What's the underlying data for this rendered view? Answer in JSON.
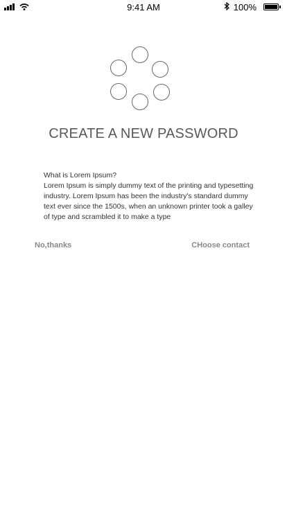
{
  "status_bar": {
    "time": "9:41 AM",
    "battery_percent": "100%",
    "icons": [
      "signal-icon",
      "wifi-icon",
      "bluetooth-icon",
      "battery-icon"
    ]
  },
  "screen": {
    "title": "CREATE A NEW PASSWORD",
    "description_heading": "What is Lorem Ipsum?",
    "description_body": "Lorem Ipsum is simply dummy text of the printing and typesetting industry. Lorem Ipsum has been the industry's standard dummy text ever since the 1500s, when an unknown printer took a galley of type and scrambled it to make a type",
    "pattern_dot_count": 6
  },
  "actions": {
    "decline_label": "No,thanks",
    "choose_label": "CHoose contact"
  },
  "colors": {
    "title": "#595959",
    "action_text": "#888888",
    "dot_border": "#666666"
  }
}
